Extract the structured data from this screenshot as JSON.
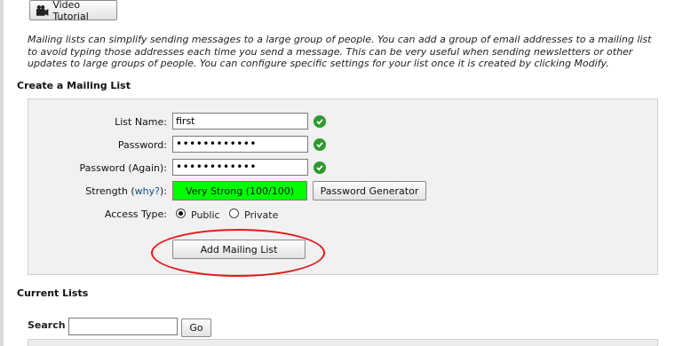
{
  "toolbar": {
    "video_tutorial_label": "Video Tutorial",
    "video_icon": "camera-icon"
  },
  "intro_text": "Mailing lists can simplify sending messages to a large group of people. You can add a group of email addresses to a mailing list to avoid typing those addresses each time you send a message. This can be very useful when sending newsletters or other updates to large groups of people. You can configure specific settings for your list once it is created by clicking Modify.",
  "create_section": {
    "heading": "Create a Mailing List",
    "list_name": {
      "label": "List Name:",
      "value": "first"
    },
    "password": {
      "label": "Password:",
      "value": "••••••••••••"
    },
    "password_again": {
      "label": "Password (Again):",
      "value": "••••••••••••"
    },
    "strength": {
      "label_prefix": "Strength (",
      "why_link": "why?",
      "label_suffix": "):",
      "value": "Very Strong (100/100)",
      "color": "#00ff00"
    },
    "password_generator_label": "Password Generator",
    "access_type": {
      "label": "Access Type:",
      "options": [
        "Public",
        "Private"
      ],
      "selected": "Public"
    },
    "add_button_label": "Add Mailing List",
    "valid_icon": "check-icon",
    "highlight_color": "#e21b1b"
  },
  "current_section": {
    "heading": "Current Lists",
    "search_label": "Search",
    "search_value": "",
    "go_label": "Go"
  }
}
